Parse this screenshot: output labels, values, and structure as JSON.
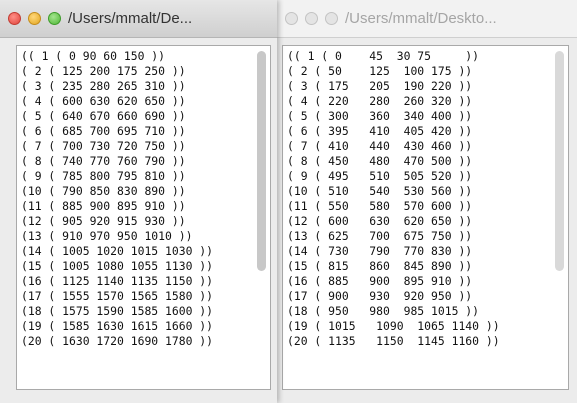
{
  "windows": [
    {
      "title": "/Users/mmalt/De...",
      "active": true,
      "lines": [
        "(( 1 ( 0 90 60 150 ))",
        "( 2 ( 125 200 175 250 ))",
        "( 3 ( 235 280 265 310 ))",
        "( 4 ( 600 630 620 650 ))",
        "( 5 ( 640 670 660 690 ))",
        "( 6 ( 685 700 695 710 ))",
        "( 7 ( 700 730 720 750 ))",
        "( 8 ( 740 770 760 790 ))",
        "( 9 ( 785 800 795 810 ))",
        "(10 ( 790 850 830 890 ))",
        "(11 ( 885 900 895 910 ))",
        "(12 ( 905 920 915 930 ))",
        "(13 ( 910 970 950 1010 ))",
        "(14 ( 1005 1020 1015 1030 ))",
        "(15 ( 1005 1080 1055 1130 ))",
        "(16 ( 1125 1140 1135 1150 ))",
        "(17 ( 1555 1570 1565 1580 ))",
        "(18 ( 1575 1590 1585 1600 ))",
        "(19 ( 1585 1630 1615 1660 ))",
        "(20 ( 1630 1720 1690 1780 ))"
      ]
    },
    {
      "title": "/Users/mmalt/Deskto...",
      "active": false,
      "lines": [
        "(( 1 ( 0    45  30 75     ))",
        "( 2 ( 50    125  100 175 ))",
        "( 3 ( 175   205  190 220 ))",
        "( 4 ( 220   280  260 320 ))",
        "( 5 ( 300   360  340 400 ))",
        "( 6 ( 395   410  405 420 ))",
        "( 7 ( 410   440  430 460 ))",
        "( 8 ( 450   480  470 500 ))",
        "( 9 ( 495   510  505 520 ))",
        "(10 ( 510   540  530 560 ))",
        "(11 ( 550   580  570 600 ))",
        "(12 ( 600   630  620 650 ))",
        "(13 ( 625   700  675 750 ))",
        "(14 ( 730   790  770 830 ))",
        "(15 ( 815   860  845 890 ))",
        "(16 ( 885   900  895 910 ))",
        "(17 ( 900   930  920 950 ))",
        "(18 ( 950   980  985 1015 ))",
        "(19 ( 1015   1090  1065 1140 ))",
        "(20 ( 1135   1150  1145 1160 ))"
      ]
    }
  ]
}
